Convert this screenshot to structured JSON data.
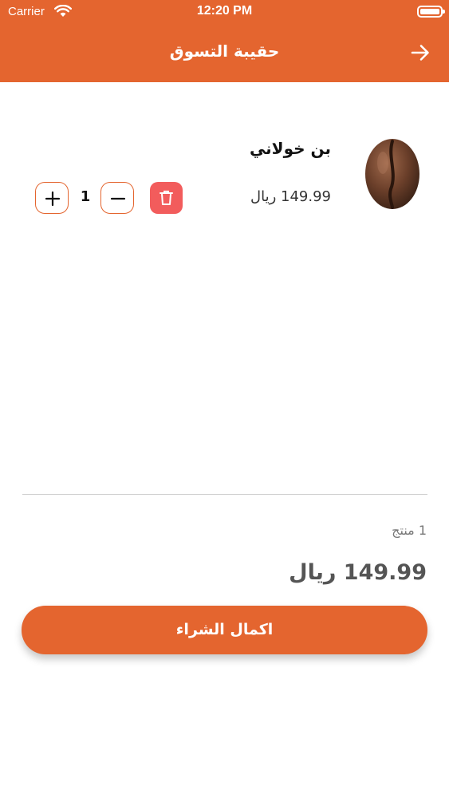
{
  "status_bar": {
    "carrier": "Carrier",
    "time": "12:20 PM"
  },
  "header": {
    "title": "حقيبة التسوق",
    "back_icon": "arrow-right-icon"
  },
  "cart": {
    "items": [
      {
        "name": "بن خولاني",
        "price": "149.99 ريال",
        "quantity": "1",
        "image_icon": "coffee-bean-image"
      }
    ]
  },
  "summary": {
    "count": "1 منتج",
    "total": "149.99 ريال"
  },
  "checkout": {
    "label": "اكمال الشراء"
  },
  "colors": {
    "primary": "#E4652F",
    "delete": "#F25C5C",
    "divider": "#cfcfcf"
  }
}
